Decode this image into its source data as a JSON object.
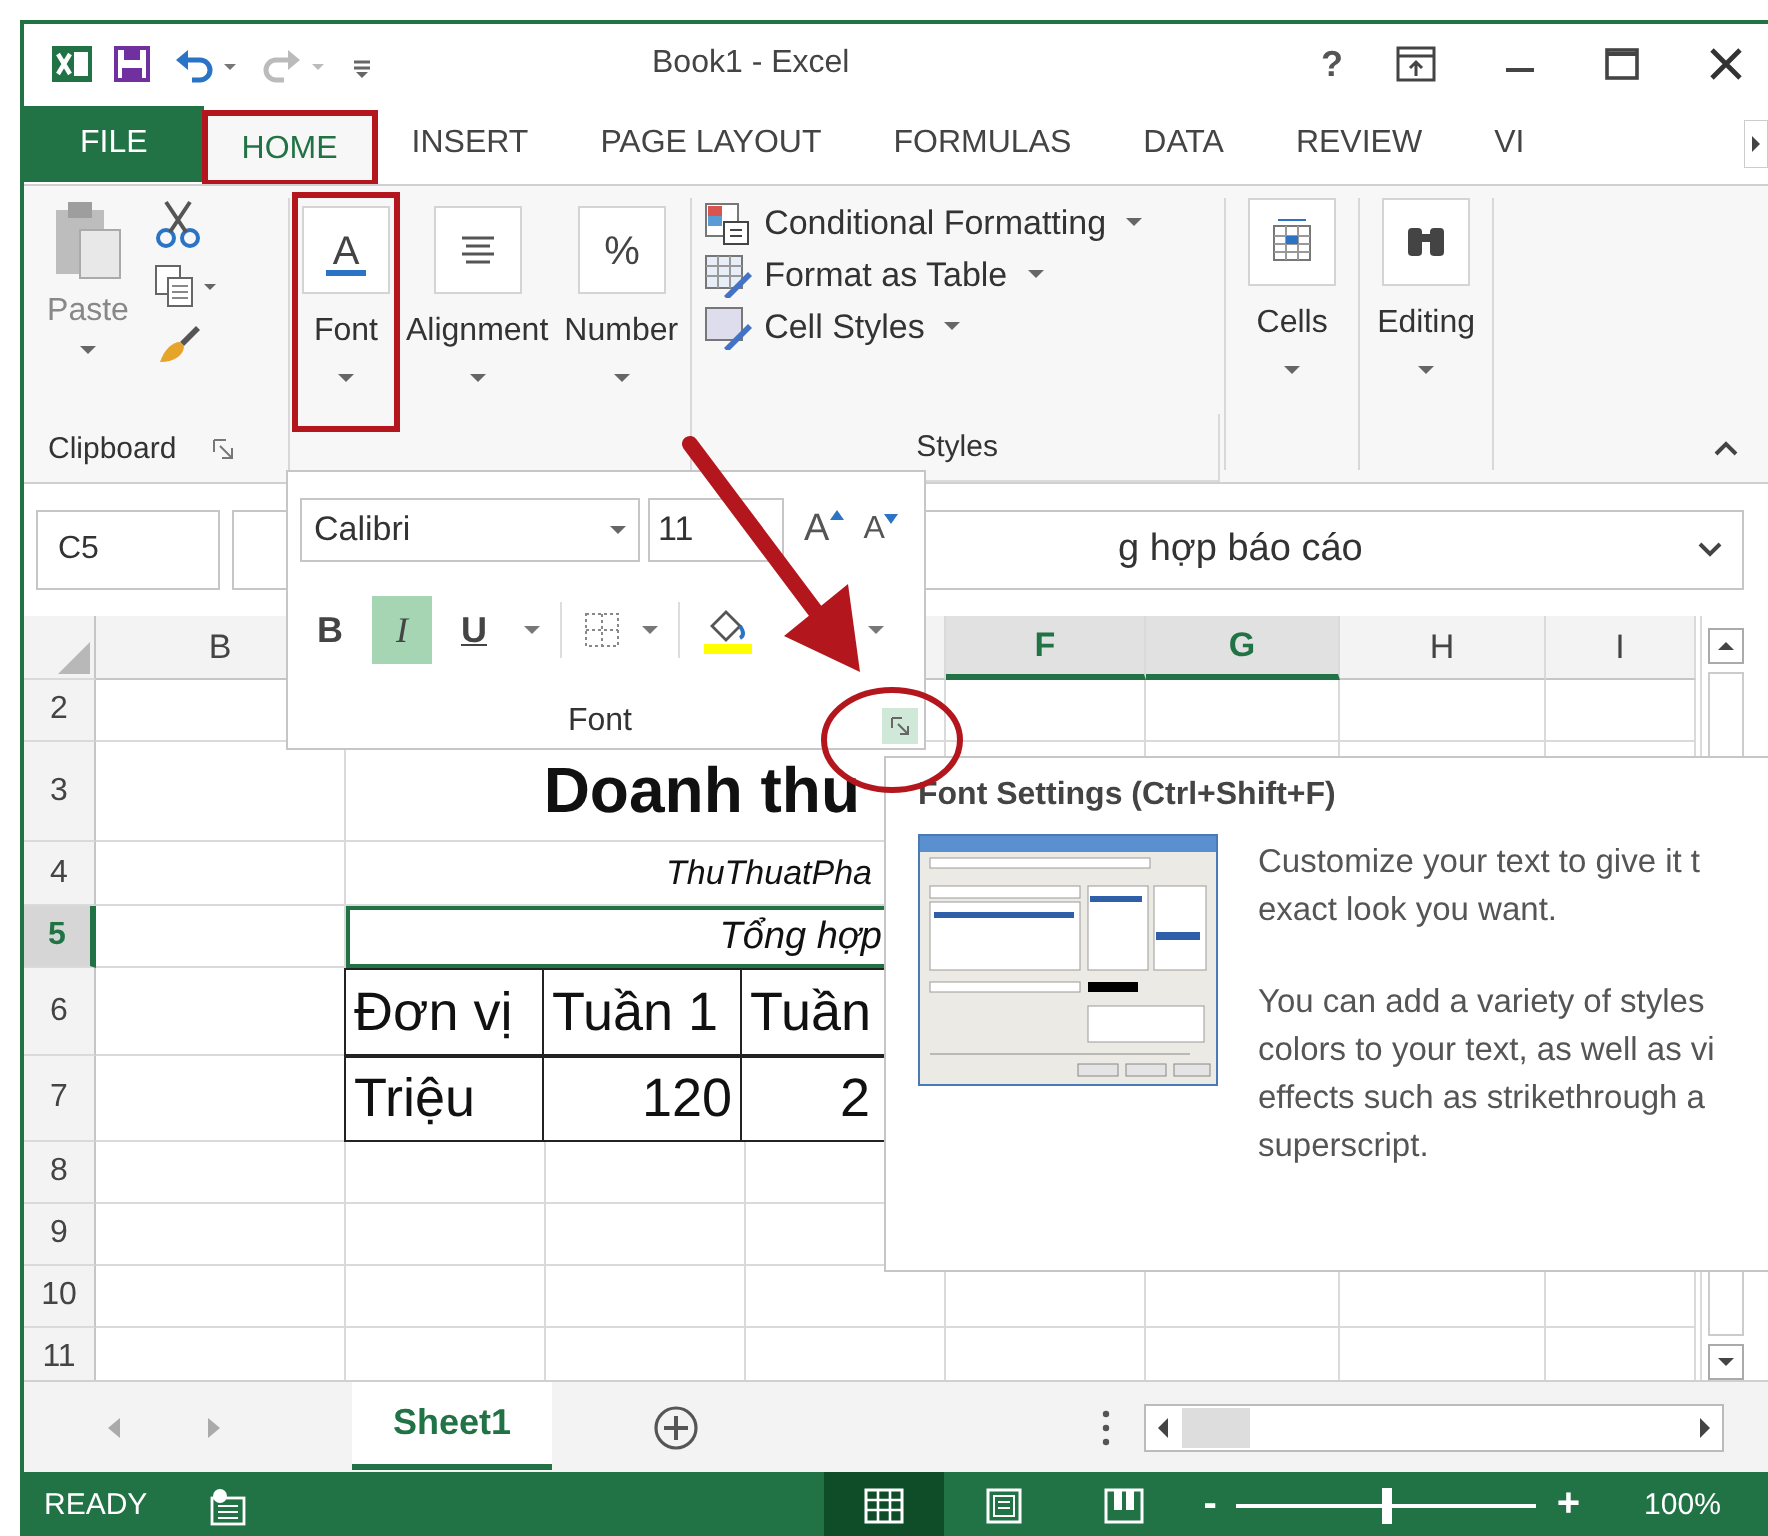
{
  "window": {
    "title": "Book1 - Excel",
    "help": "?"
  },
  "tabs": [
    {
      "label": "FILE",
      "kind": "file",
      "selected": false,
      "highlighted": false
    },
    {
      "label": "HOME",
      "kind": "tab",
      "selected": true,
      "highlighted": true
    },
    {
      "label": "INSERT",
      "kind": "tab",
      "selected": false,
      "highlighted": false
    },
    {
      "label": "PAGE LAYOUT",
      "kind": "tab",
      "selected": false,
      "highlighted": false
    },
    {
      "label": "FORMULAS",
      "kind": "tab",
      "selected": false,
      "highlighted": false
    },
    {
      "label": "DATA",
      "kind": "tab",
      "selected": false,
      "highlighted": false
    },
    {
      "label": "REVIEW",
      "kind": "tab",
      "selected": false,
      "highlighted": false
    },
    {
      "label": "VI",
      "kind": "tab",
      "selected": false,
      "highlighted": false
    }
  ],
  "ribbon": {
    "clipboard": {
      "paste": {
        "label": "Paste",
        "disabled": true
      },
      "label": "Clipboard"
    },
    "buttons": [
      {
        "label": "Font",
        "kind": "glyph",
        "glyph": "A",
        "highlighted": true
      },
      {
        "label": "Alignment",
        "kind": "align",
        "highlighted": false
      },
      {
        "label": "Number",
        "kind": "glyph",
        "glyph": "%",
        "highlighted": false
      }
    ],
    "styles": {
      "items": [
        {
          "label": "Conditional Formatting",
          "kind": "conditional"
        },
        {
          "label": "Format as Table",
          "kind": "table"
        },
        {
          "label": "Cell Styles",
          "kind": "cellstyles"
        }
      ],
      "label": "Styles"
    },
    "tail": [
      {
        "label": "Cells",
        "kind": "cells"
      },
      {
        "label": "Editing",
        "kind": "editing"
      }
    ]
  },
  "formula_bar": {
    "name_box": "C5",
    "value": "g hợp báo cáo"
  },
  "columns": [
    {
      "label": "B",
      "selected": false
    },
    {
      "label": "F",
      "selected": true
    },
    {
      "label": "G",
      "selected": true
    },
    {
      "label": "H",
      "selected": false
    },
    {
      "label": "I",
      "selected": false
    }
  ],
  "rows": [
    {
      "number": "2",
      "kind": "empty",
      "selected": false
    },
    {
      "number": "3",
      "kind": "title",
      "text": "Doanh thu",
      "selected": false
    },
    {
      "number": "4",
      "kind": "subtitle",
      "text": "ThuThuatPha",
      "selected": false
    },
    {
      "number": "5",
      "kind": "merged",
      "text": "Tổng hợp",
      "selected": true
    },
    {
      "number": "6",
      "kind": "table-header",
      "cells": [
        "Đơn vị",
        "Tuần 1",
        "Tuần"
      ],
      "selected": false
    },
    {
      "number": "7",
      "kind": "table-data",
      "cells": [
        "Triệu",
        "120",
        "2"
      ],
      "selected": false
    },
    {
      "number": "8",
      "kind": "empty",
      "selected": false
    },
    {
      "number": "9",
      "kind": "empty",
      "selected": false
    },
    {
      "number": "10",
      "kind": "empty",
      "selected": false
    },
    {
      "number": "11",
      "kind": "empty",
      "selected": false
    }
  ],
  "font_popup": {
    "font_name": "Calibri",
    "font_size": "11",
    "grow": "A",
    "shrink": "A",
    "styles": [
      {
        "label": "B",
        "kind": "bold",
        "selected": false
      },
      {
        "label": "I",
        "kind": "italic",
        "selected": true
      },
      {
        "label": "U",
        "kind": "underline",
        "selected": false
      }
    ],
    "label": "Font"
  },
  "tooltip": {
    "title": "Font Settings (Ctrl+Shift+F)",
    "paragraphs": [
      [
        "Customize your text to give it t",
        "exact look you want."
      ],
      [
        "You can add a variety of styles",
        "colors to your text, as well as vi",
        "effects such as strikethrough a",
        "superscript."
      ]
    ]
  },
  "sheet_tabs": [
    {
      "label": "Sheet1",
      "selected": true
    }
  ],
  "status_bar": {
    "state": "READY",
    "views": [
      {
        "kind": "normal",
        "selected": true
      },
      {
        "kind": "layout",
        "selected": false
      },
      {
        "kind": "pagebreak",
        "selected": false
      }
    ],
    "zoom_minus": "-",
    "zoom_plus": "+",
    "zoom": {
      "level": 0.5
    },
    "zoom_text": "100%"
  }
}
